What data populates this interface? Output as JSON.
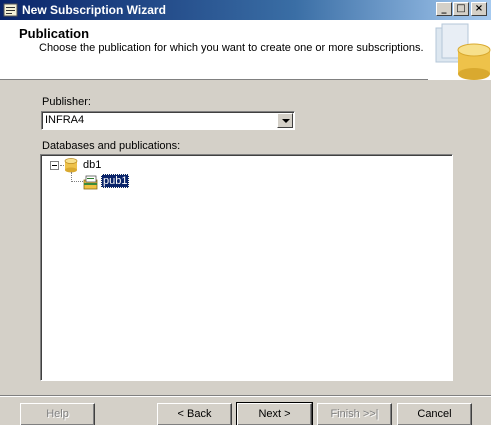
{
  "window": {
    "title": "New Subscription Wizard",
    "controls": {
      "minimize": "_",
      "maximize": "□",
      "close": "×"
    }
  },
  "header": {
    "title": "Publication",
    "subtitle": "Choose the publication for which you want to create one or more subscriptions."
  },
  "publisher": {
    "label": "Publisher:",
    "value": "INFRA4"
  },
  "tree": {
    "label": "Databases and publications:",
    "database": "db1",
    "publication": "pub1"
  },
  "buttons": {
    "help": "Help",
    "back": "< Back",
    "next": "Next >",
    "finish": "Finish >>|",
    "cancel": "Cancel"
  },
  "colors": {
    "selection": "#0a246a",
    "dialog_bg": "#d4d0c8",
    "title_bar": "#0a246a"
  }
}
